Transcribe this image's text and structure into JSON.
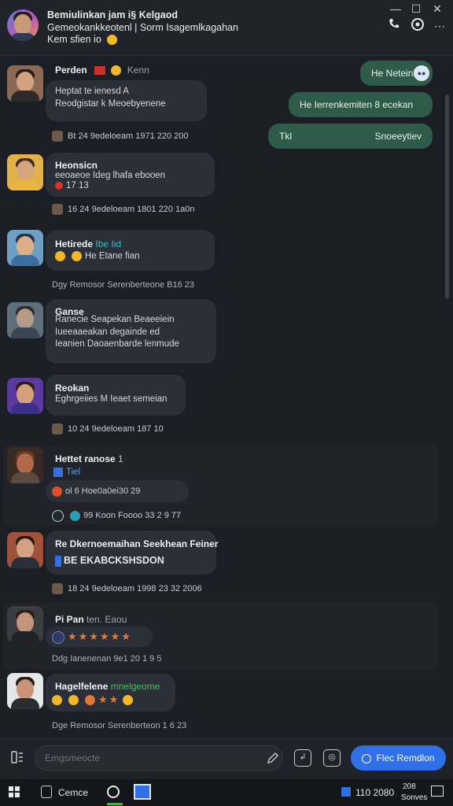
{
  "header": {
    "title": "Bemiulinkan jam  i§ Kelgaod",
    "subtitle": "Gemeokankkeotenl  |  Sorm Isagemlkagahan",
    "status": "Kem sfien io",
    "icons": [
      "minimize-icon",
      "maximize-icon",
      "close-icon",
      "phone-icon",
      "video-icon",
      "more-icon"
    ]
  },
  "outgoing": [
    {
      "text": "He Neteinie"
    },
    {
      "text": "He Ierrenkemiten 8 ecekan"
    },
    {
      "text_left": "Tkl",
      "text_right": "Snoeeytiev"
    }
  ],
  "messages": [
    {
      "sender": "Perden",
      "tag": "Kenn",
      "line1": "Heptat  te  ienesd A",
      "line2": "Reodgistar k  Meoebyenene",
      "meta": "Bt  24 9edeloeam 1971  220 200"
    },
    {
      "sender": "Heonsicn",
      "line1": "eeoaeoe  Ideg lhafa  ebooen",
      "line2": "17 13",
      "meta": "16  24 9edeloeam 1801  220 1a0n"
    },
    {
      "sender": "Hetirede",
      "tag": "Ibe  Iid",
      "line1": "He Etane  fian",
      "system": "Dgy  Remosor  Serenberteone  B16 23"
    },
    {
      "sender": "Ganse",
      "line1": "Ranecie  Seapekan  Beaeeiein",
      "line2": "Iueeaaeakan degainde   ed",
      "line3": "Ieanien  Daoaenbarde  lenmude"
    },
    {
      "sender": "Reokan",
      "line1": "Eghrgeiies  M Ieaet semeian",
      "meta": "10  24 9edeloeam  187 10"
    },
    {
      "sender": "Hettet ranose",
      "tag": "1",
      "line1": "Tiel",
      "meta1": "ol  6 Hoe0a0ei30 29",
      "meta2": "99 Koon  Foooo 33 2 9 77"
    },
    {
      "sender": "Re Dkernoemaihan Seekhean  Feiner",
      "line1": "BE EKABCKSHSDON",
      "meta": "18  24 9edeloeam 1998  23 32 2006"
    },
    {
      "sender": "Pi  Pan",
      "tag": "ten.   Eaou",
      "stars": "★★★★★★",
      "system": "Ddg  Ianenenan  9e1  20 1 9 5"
    },
    {
      "sender": "Hagelfelene",
      "tag": "mnelgeome",
      "system": "Dge  Remosor  Serenberteon  1 6 23"
    }
  ],
  "composer": {
    "placeholder": "Emgsmeocte",
    "send_label": "Flec Remdlon"
  },
  "taskbar": {
    "app_label": "Cemce",
    "clock_a": "110  2080",
    "clock_b": "208",
    "clock_c": "Sonves"
  },
  "colors": {
    "background": "#1b1e24",
    "bubble_in": "#2b2f37",
    "bubble_out": "#2e5a4a",
    "accent": "#2f6fe8"
  }
}
